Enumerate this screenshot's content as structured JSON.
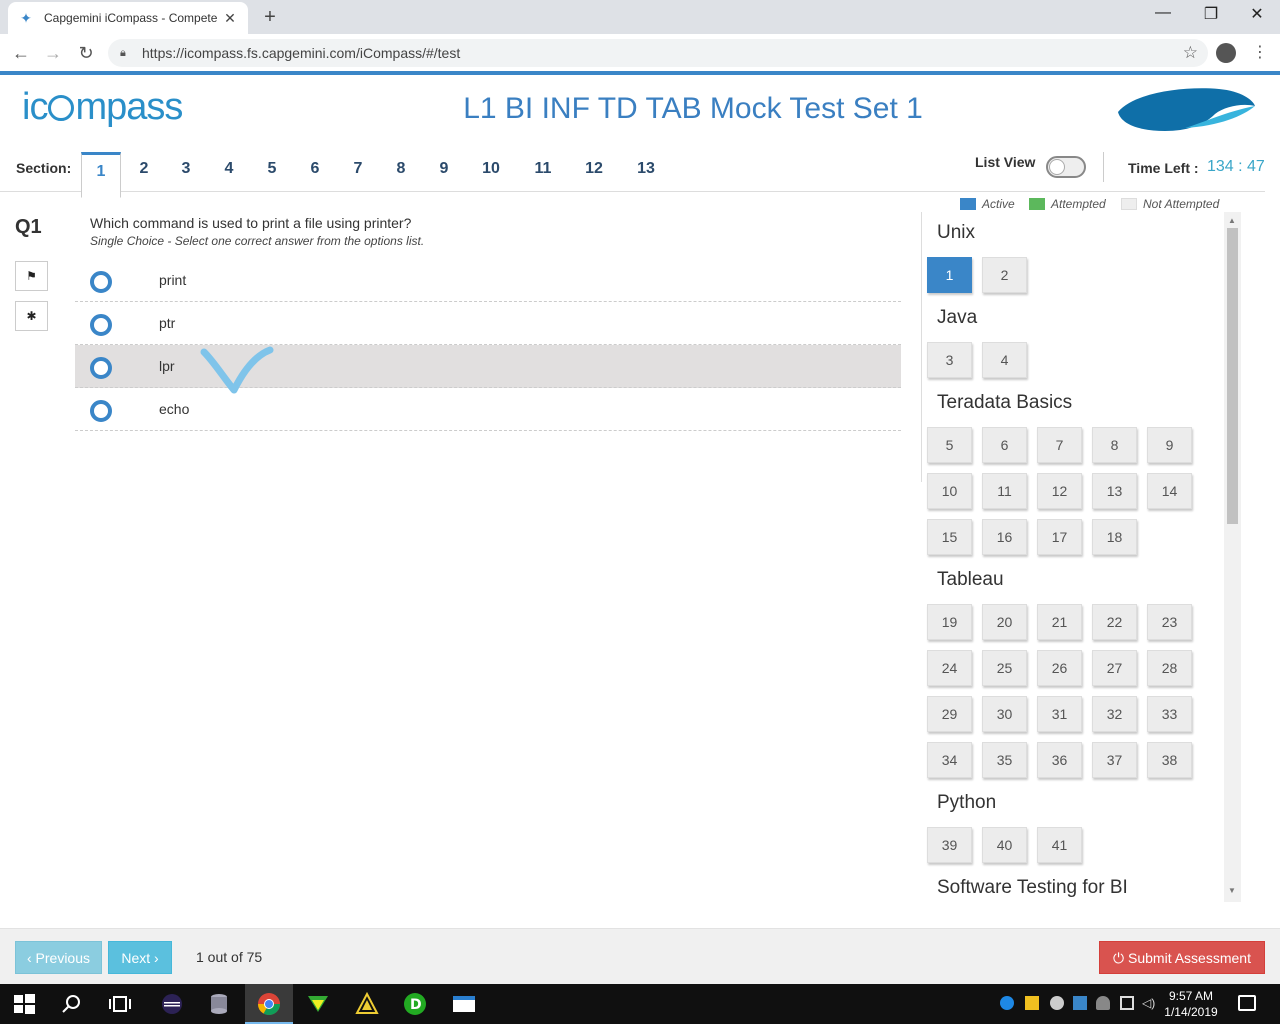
{
  "browser": {
    "tab_title": "Capgemini iCompass - Compete",
    "url": "https://icompass.fs.capgemini.com/iCompass/#/test"
  },
  "header": {
    "logo_prefix": "ic",
    "logo_suffix": "mpass",
    "test_title": "L1 BI INF TD TAB Mock Test Set 1"
  },
  "sections": {
    "label": "Section:",
    "tabs": [
      "1",
      "2",
      "3",
      "4",
      "5",
      "6",
      "7",
      "8",
      "9",
      "10",
      "11",
      "12",
      "13"
    ],
    "active": "1"
  },
  "list_view_label": "List View",
  "time": {
    "label": "Time Left :",
    "value": "134 : 47"
  },
  "legend": {
    "active": "Active",
    "attempted": "Attempted",
    "not_attempted": "Not Attempted"
  },
  "colors": {
    "active": "#3a86c8",
    "attempted": "#5cb85c",
    "not_attempted": "#eeeeee",
    "submit": "#d9534f"
  },
  "question": {
    "number": "Q1",
    "text": "Which command is used to print a file using printer?",
    "hint": "Single Choice - Select one correct answer from the options list.",
    "options": [
      "print",
      "ptr",
      "lpr",
      "echo"
    ],
    "highlighted_option": "lpr",
    "icons": [
      "flag-icon",
      "bug-icon"
    ]
  },
  "panel": {
    "groups": [
      {
        "name": "Unix",
        "questions": [
          "1",
          "2"
        ]
      },
      {
        "name": "Java",
        "questions": [
          "3",
          "4"
        ]
      },
      {
        "name": "Teradata Basics",
        "questions": [
          "5",
          "6",
          "7",
          "8",
          "9",
          "10",
          "11",
          "12",
          "13",
          "14",
          "15",
          "16",
          "17",
          "18"
        ]
      },
      {
        "name": "Tableau",
        "questions": [
          "19",
          "20",
          "21",
          "22",
          "23",
          "24",
          "25",
          "26",
          "27",
          "28",
          "29",
          "30",
          "31",
          "32",
          "33",
          "34",
          "35",
          "36",
          "37",
          "38"
        ]
      },
      {
        "name": "Python",
        "questions": [
          "39",
          "40",
          "41"
        ]
      },
      {
        "name": "Software Testing for BI",
        "questions": []
      }
    ],
    "active_question": "1"
  },
  "footer": {
    "previous": "‹ Previous",
    "next": "Next ›",
    "progress": "1 out of 75",
    "submit": "Submit Assessment"
  },
  "taskbar": {
    "time": "9:57 AM",
    "date": "1/14/2019"
  }
}
